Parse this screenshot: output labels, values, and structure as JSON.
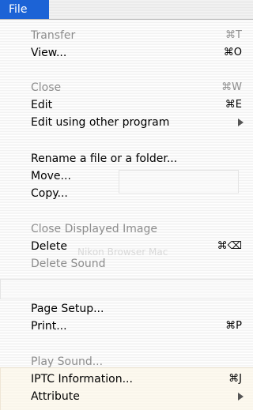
{
  "menubar": {
    "title": "File"
  },
  "ghost_text": {
    "browser_title": "Nikon Browser Mac"
  },
  "menu": {
    "items": [
      {
        "label": "Transfer",
        "shortcut": "⌘T",
        "disabled": true
      },
      {
        "label": "View...",
        "shortcut": "⌘O",
        "disabled": false
      },
      {
        "label": "Close",
        "shortcut": "⌘W",
        "disabled": true
      },
      {
        "label": "Edit",
        "shortcut": "⌘E",
        "disabled": false
      },
      {
        "label": "Edit using other program",
        "shortcut": "",
        "disabled": false,
        "submenu": true
      },
      {
        "label": "Rename a file or a folder...",
        "shortcut": "",
        "disabled": false
      },
      {
        "label": "Move...",
        "shortcut": "",
        "disabled": false
      },
      {
        "label": "Copy...",
        "shortcut": "",
        "disabled": false
      },
      {
        "label": "Close Displayed Image",
        "shortcut": "",
        "disabled": true
      },
      {
        "label": "Delete",
        "shortcut": "⌘⌫",
        "disabled": false
      },
      {
        "label": "Delete Sound",
        "shortcut": "",
        "disabled": true
      },
      {
        "label": "Page Setup...",
        "shortcut": "",
        "disabled": false
      },
      {
        "label": "Print...",
        "shortcut": "⌘P",
        "disabled": false
      },
      {
        "label": "Play Sound...",
        "shortcut": "",
        "disabled": true
      },
      {
        "label": "IPTC Information...",
        "shortcut": "⌘J",
        "disabled": false
      },
      {
        "label": "Attribute",
        "shortcut": "",
        "disabled": false,
        "submenu": true
      }
    ]
  }
}
